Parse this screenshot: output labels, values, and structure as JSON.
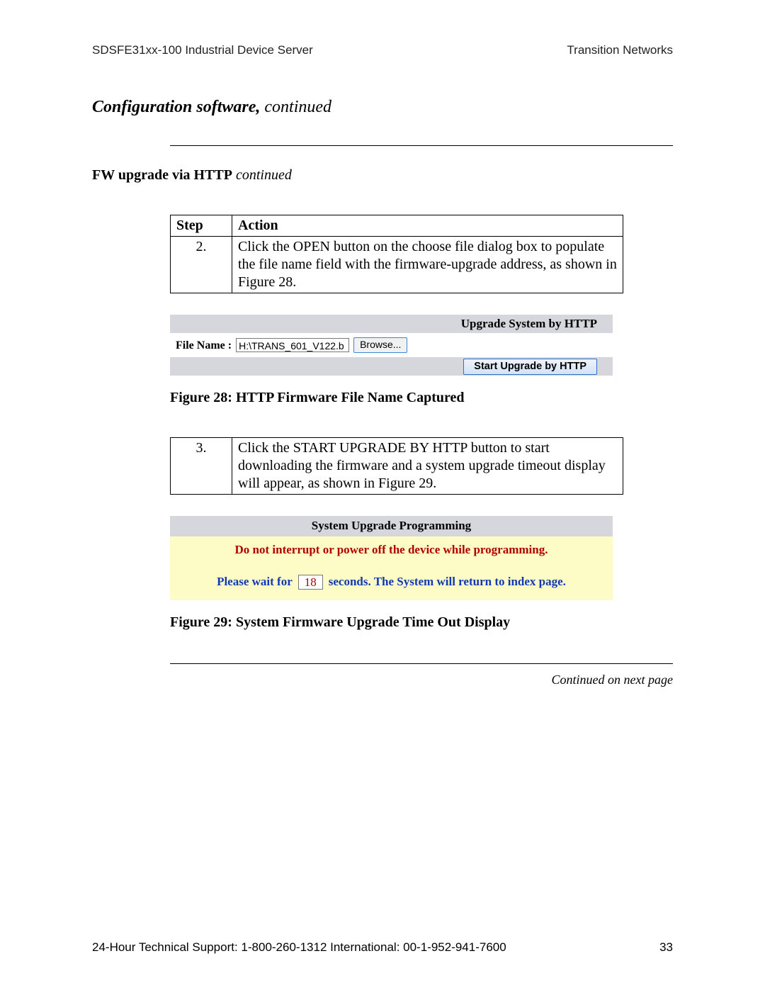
{
  "header": {
    "left": "SDSFE31xx-100 Industrial Device Server",
    "right": "Transition Networks"
  },
  "section_title": {
    "bold": "Configuration software,",
    "cont": " continued"
  },
  "sub_heading": {
    "bold": "FW upgrade via HTTP",
    "cont": " continued"
  },
  "step_table1": {
    "head_step": "Step",
    "head_action": "Action",
    "row": {
      "num": "2.",
      "text": "Click the OPEN button on the choose file dialog box to populate the file name field with the firmware-upgrade address, as shown in Figure 28."
    }
  },
  "panel_http": {
    "title": "Upgrade System by HTTP",
    "file_label": "File Name :",
    "file_value": "H:\\TRANS_601_V122.b",
    "browse": "Browse...",
    "start_btn": "Start Upgrade by HTTP"
  },
  "figure28": "Figure 28:  HTTP Firmware File Name Captured",
  "step_table2": {
    "num": "3.",
    "text": "Click the START UPGRADE BY HTTP button to start downloading the firmware and a system upgrade timeout display will appear, as shown in Figure 29."
  },
  "panel_prog": {
    "title": "System Upgrade Programming",
    "warning": "Do not interrupt or power off the device while programming.",
    "wait_prefix": "Please wait for",
    "seconds": "18",
    "wait_suffix": "seconds. The System will return to index page."
  },
  "figure29": "Figure 29:  System Firmware Upgrade Time Out Display",
  "continued": "Continued on next page",
  "footer": {
    "left": "24-Hour Technical Support:  1-800-260-1312   International: 00-1-952-941-7600",
    "page": "33"
  }
}
